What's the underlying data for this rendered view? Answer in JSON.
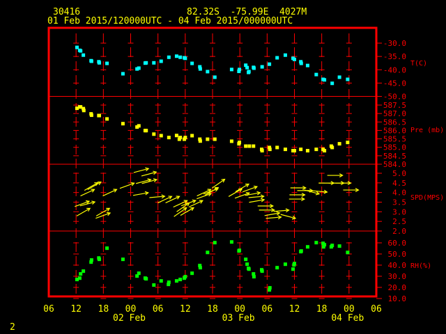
{
  "header": {
    "station": "30416",
    "location": "82.32S  -75.99E  4027M",
    "period": "01 Feb 2015/120000UTC - 04 Feb 2015/000000UTC"
  },
  "page_number": "2",
  "colors": {
    "frame": "#ff0000",
    "text": "#ffff00",
    "temperature": "#00ffff",
    "pressure": "#ffff00",
    "wind": "#ffff00",
    "rh": "#00ff00"
  },
  "chart_data": [
    {
      "type": "scatter",
      "title": "T(C)",
      "ylabel": "T(C)",
      "x_units": "hours since 01 Feb 2015 12UTC",
      "ylim": [
        -50,
        -30
      ],
      "yticks": [
        "-30.0",
        "-35.0",
        "-40.0",
        "-45.0",
        "-50.0"
      ],
      "ytick_values": [
        -30,
        -35,
        -40,
        -45,
        -50
      ],
      "x": [
        0.2,
        0.8,
        1.0,
        1.6,
        3.3,
        3.4,
        5.0,
        5.1,
        6.8,
        10.3,
        13.4,
        13.8,
        15.2,
        15.4,
        17.1,
        18.7,
        20.4,
        22.1,
        22.9,
        23.8,
        24.0,
        25.5,
        27.2,
        27.3,
        28.9,
        30.5,
        34.2,
        35.8,
        35.9,
        37.3,
        37.6,
        37.9,
        38.0,
        39.0,
        39.1,
        40.9,
        42.5,
        44.2,
        46.0,
        47.7,
        48.0,
        49.4,
        49.5,
        50.9,
        52.8,
        54.3,
        54.6,
        56.3,
        57.9,
        59.7
      ],
      "y": [
        -31.6,
        -32.7,
        -32.9,
        -34.5,
        -36.6,
        -36.8,
        -37.0,
        -37.4,
        -37.6,
        -41.5,
        -39.7,
        -39.4,
        -37.5,
        -37.4,
        -37.4,
        -36.8,
        -35.3,
        -34.9,
        -35.3,
        -35.5,
        -35.7,
        -37.6,
        -38.9,
        -39.7,
        -40.7,
        -42.8,
        -39.9,
        -40.6,
        -39.9,
        -38.3,
        -39.2,
        -41.0,
        -40.7,
        -39.1,
        -39.4,
        -38.9,
        -37.9,
        -35.5,
        -34.5,
        -35.7,
        -36.1,
        -37.0,
        -37.6,
        -38.4,
        -41.8,
        -43.6,
        -43.8,
        -45.1,
        -42.8,
        -43.6
      ]
    },
    {
      "type": "scatter",
      "title": "Pre (mb)",
      "ylabel": "Pre (mb)",
      "ylim": [
        584.0,
        587.5
      ],
      "yticks": [
        "587.5",
        "587.0",
        "586.5",
        "586.0",
        "585.5",
        "585.0",
        "584.5",
        "584.0"
      ],
      "ytick_values": [
        587.5,
        587.0,
        586.5,
        586.0,
        585.5,
        585.0,
        584.5,
        584.0
      ],
      "x": [
        0.2,
        0.8,
        1.0,
        1.6,
        1.7,
        3.3,
        3.4,
        5.0,
        5.1,
        6.8,
        10.3,
        13.4,
        13.8,
        15.2,
        15.4,
        17.1,
        18.7,
        20.4,
        22.1,
        22.9,
        22.7,
        24.0,
        23.8,
        25.5,
        27.2,
        27.3,
        28.9,
        30.5,
        34.2,
        35.8,
        35.9,
        37.3,
        38.1,
        39.0,
        40.8,
        40.9,
        42.5,
        42.6,
        44.2,
        46.0,
        47.7,
        48.0,
        49.4,
        50.9,
        52.8,
        54.3,
        54.6,
        56.1,
        56.3,
        57.9,
        59.7
      ],
      "y": [
        587.31,
        587.39,
        587.39,
        587.29,
        587.18,
        586.98,
        586.9,
        586.88,
        586.88,
        586.68,
        586.4,
        586.2,
        586.27,
        585.99,
        585.99,
        585.78,
        585.69,
        585.58,
        585.7,
        585.58,
        585.48,
        585.58,
        585.48,
        585.69,
        585.48,
        585.37,
        585.48,
        585.48,
        585.36,
        585.21,
        585.29,
        585.07,
        585.07,
        585.07,
        584.88,
        584.8,
        584.99,
        584.88,
        584.99,
        584.88,
        584.8,
        584.8,
        584.88,
        584.8,
        584.88,
        584.88,
        584.8,
        585.07,
        584.99,
        585.21,
        585.29
      ]
    },
    {
      "type": "scatter",
      "title": "SPD(MPS)",
      "ylabel": "SPD(MPS)",
      "ylim": [
        2.0,
        5.0
      ],
      "yticks": [
        "5.0",
        "4.5",
        "4.0",
        "3.5",
        "3.0",
        "2.5",
        "2.0"
      ],
      "ytick_values": [
        5.0,
        4.5,
        4.0,
        3.5,
        3.0,
        2.5,
        2.0
      ],
      "marker": "wind arrow (arrow angle = direction toward, degrees from east)",
      "x": [
        3.3,
        4.0,
        2.5,
        1.3,
        2.5,
        1.6,
        5.9,
        5.9,
        7.4,
        11.2,
        14.3,
        16.0,
        14.8,
        16.1,
        14.2,
        17.8,
        19.5,
        21.2,
        22.9,
        24.7,
        26.3,
        23.5,
        22.9,
        24.4,
        28.1,
        28.1,
        29.8,
        31.3,
        29.6,
        35.0,
        36.5,
        38.2,
        36.5,
        38.8,
        39.6,
        39.7,
        41.6,
        41.9,
        43.1,
        43.4,
        45.1,
        46.6,
        48.8,
        48.6,
        48.5,
        50.3,
        51.8,
        53.5,
        55.0,
        57.2,
        58.7,
        56.9,
        60.4
      ],
      "y": [
        4.31,
        4.35,
        3.99,
        3.41,
        3.41,
        2.98,
        2.98,
        2.8,
        3.99,
        4.35,
        5.14,
        4.96,
        4.57,
        4.57,
        3.92,
        3.77,
        3.63,
        3.63,
        3.41,
        3.45,
        3.41,
        3.23,
        2.98,
        3.01,
        3.99,
        3.81,
        4.06,
        4.46,
        4.06,
        3.99,
        4.24,
        4.17,
        3.84,
        3.92,
        3.77,
        3.56,
        3.3,
        3.09,
        2.87,
        2.69,
        3.05,
        2.76,
        4.24,
        3.88,
        3.66,
        4.1,
        4.03,
        4.06,
        4.49,
        4.49,
        4.49,
        4.89,
        4.13
      ],
      "direction": [
        30,
        30,
        25,
        20,
        15,
        30,
        30,
        20,
        25,
        20,
        15,
        15,
        15,
        15,
        10,
        5,
        25,
        25,
        25,
        20,
        25,
        35,
        35,
        30,
        25,
        20,
        30,
        35,
        20,
        30,
        30,
        20,
        20,
        10,
        5,
        10,
        0,
        0,
        10,
        5,
        5,
        -15,
        0,
        0,
        0,
        0,
        -15,
        -5,
        0,
        0,
        0,
        0,
        0
      ]
    },
    {
      "type": "scatter",
      "title": "RH(%)",
      "ylabel": "RH(%)",
      "ylim": [
        10,
        60
      ],
      "yticks": [
        "60.0",
        "50.0",
        "40.0",
        "30.0",
        "20.0",
        "10.0"
      ],
      "ytick_values": [
        60,
        50,
        40,
        30,
        20,
        10
      ],
      "x": [
        0.2,
        0.8,
        1.0,
        1.6,
        3.3,
        3.4,
        5.0,
        5.1,
        6.8,
        10.3,
        13.4,
        13.8,
        15.2,
        15.4,
        17.1,
        18.7,
        20.4,
        20.3,
        22.1,
        22.9,
        23.8,
        24.0,
        25.5,
        27.2,
        27.3,
        28.9,
        30.5,
        34.2,
        35.8,
        35.9,
        37.3,
        37.6,
        37.9,
        38.0,
        39.0,
        39.1,
        40.8,
        40.9,
        42.5,
        42.6,
        44.2,
        46.0,
        47.7,
        47.9,
        48.0,
        49.4,
        49.5,
        50.9,
        52.8,
        54.3,
        54.6,
        54.4,
        56.1,
        56.3,
        57.9,
        59.7
      ],
      "y": [
        27.1,
        28.3,
        32.1,
        34.6,
        42.7,
        44.6,
        46.4,
        45.2,
        55.2,
        45.2,
        30.2,
        32.7,
        28.3,
        27.7,
        22.1,
        25.8,
        24.6,
        22.7,
        25.8,
        27.1,
        28.3,
        29.6,
        32.7,
        39.6,
        37.7,
        51.4,
        60.2,
        60.8,
        52.7,
        53.3,
        45.2,
        40.8,
        37.1,
        36.4,
        32.1,
        29.6,
        35.8,
        34.6,
        17.7,
        19.6,
        37.7,
        40.8,
        36.4,
        40.2,
        41.4,
        52.1,
        52.7,
        56.4,
        60.2,
        59.6,
        58.3,
        56.4,
        56.4,
        57.7,
        57.1,
        51.4
      ]
    }
  ],
  "x_axis": {
    "xlim_hours": [
      -6,
      66
    ],
    "hour_labels": [
      "06",
      "12",
      "18",
      "00",
      "06",
      "12",
      "18",
      "00",
      "06",
      "12",
      "18",
      "00",
      "06"
    ],
    "date_labels": [
      {
        "label": "02 Feb",
        "hour": 12
      },
      {
        "label": "03 Feb",
        "hour": 36
      },
      {
        "label": "04 Feb",
        "hour": 60
      }
    ]
  }
}
